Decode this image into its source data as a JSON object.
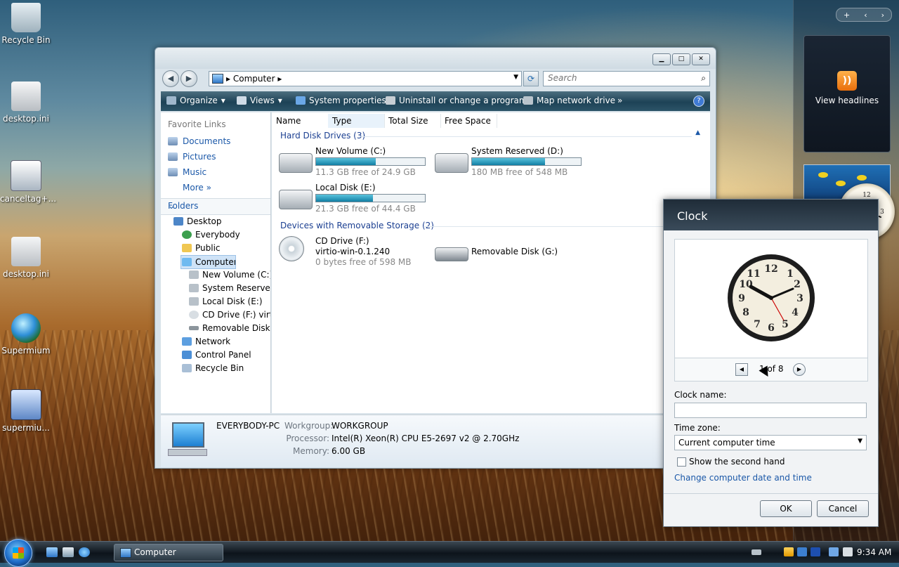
{
  "desktop": {
    "icons": [
      {
        "label": "Recycle Bin",
        "icon": "recycle-bin-icon"
      },
      {
        "label": "desktop.ini",
        "icon": "ini-file-icon"
      },
      {
        "label": "canceltag+...",
        "icon": "settings-file-icon"
      },
      {
        "label": "desktop.ini",
        "icon": "ini-file-icon"
      },
      {
        "label": "Supermium",
        "icon": "browser-icon"
      },
      {
        "label": "supermiu...",
        "icon": "installer-icon"
      }
    ]
  },
  "explorer": {
    "title": "Computer",
    "address": {
      "crumb": "Computer"
    },
    "search": {
      "placeholder": "Search"
    },
    "toolbar": [
      {
        "label": "Organize"
      },
      {
        "label": "Views"
      },
      {
        "label": "System properties"
      },
      {
        "label": "Uninstall or change a program"
      },
      {
        "label": "Map network drive"
      },
      {
        "label": "»"
      }
    ],
    "favorites": {
      "title": "Favorite Links",
      "items": [
        {
          "label": "Documents"
        },
        {
          "label": "Pictures"
        },
        {
          "label": "Music"
        },
        {
          "label": "More  »"
        }
      ]
    },
    "folders": {
      "title": "Folders",
      "items": [
        {
          "label": "Desktop"
        },
        {
          "label": "Everybody"
        },
        {
          "label": "Public"
        },
        {
          "label": "Computer"
        },
        {
          "label": "New Volume (C:)"
        },
        {
          "label": "System Reserved ("
        },
        {
          "label": "Local Disk (E:)"
        },
        {
          "label": "CD Drive (F:) virtic"
        },
        {
          "label": "Removable Disk (("
        },
        {
          "label": "Network"
        },
        {
          "label": "Control Panel"
        },
        {
          "label": "Recycle Bin"
        }
      ]
    },
    "columns": [
      "Name",
      "Type",
      "Total Size",
      "Free Space"
    ],
    "groups": [
      {
        "title": "Hard Disk Drives (3)"
      },
      {
        "title": "Devices with Removable Storage (2)"
      }
    ],
    "drives": [
      {
        "name": "New Volume (C:)",
        "free": "11.3 GB free of 24.9 GB",
        "used_fraction": 0.55
      },
      {
        "name": "System Reserved (D:)",
        "free": "180 MB free of 548 MB",
        "used_fraction": 0.67
      },
      {
        "name": "Local Disk (E:)",
        "free": "21.3 GB free of 44.4 GB",
        "used_fraction": 0.52
      },
      {
        "name": "CD Drive (F:)",
        "line2": "virtio-win-0.1.240",
        "free": "0 bytes free of 598 MB"
      },
      {
        "name": "Removable Disk (G:)"
      }
    ],
    "details": {
      "computer_name": "EVERYBODY-PC",
      "workgroup_label": "Workgroup:",
      "workgroup": "WORKGROUP",
      "processor_label": "Processor:",
      "processor": "Intel(R) Xeon(R) CPU E5-2697 v2 @ 2.70GHz",
      "memory_label": "Memory:",
      "memory": "6.00 GB"
    }
  },
  "gadgets": {
    "feed": {
      "label": "View headlines"
    }
  },
  "clock_dialog": {
    "title": "Clock",
    "page": "1 of 8",
    "clock_name_label": "Clock name:",
    "clock_name_value": "",
    "time_zone_label": "Time zone:",
    "time_zone_value": "Current computer time",
    "second_hand_label": "Show the second hand",
    "link": "Change computer date and time",
    "ok": "OK",
    "cancel": "Cancel"
  },
  "taskbar": {
    "task": "Computer",
    "time": "9:34 AM"
  },
  "colors": {
    "accent": "#1b58a8",
    "disk_bar": "#127fa4"
  }
}
